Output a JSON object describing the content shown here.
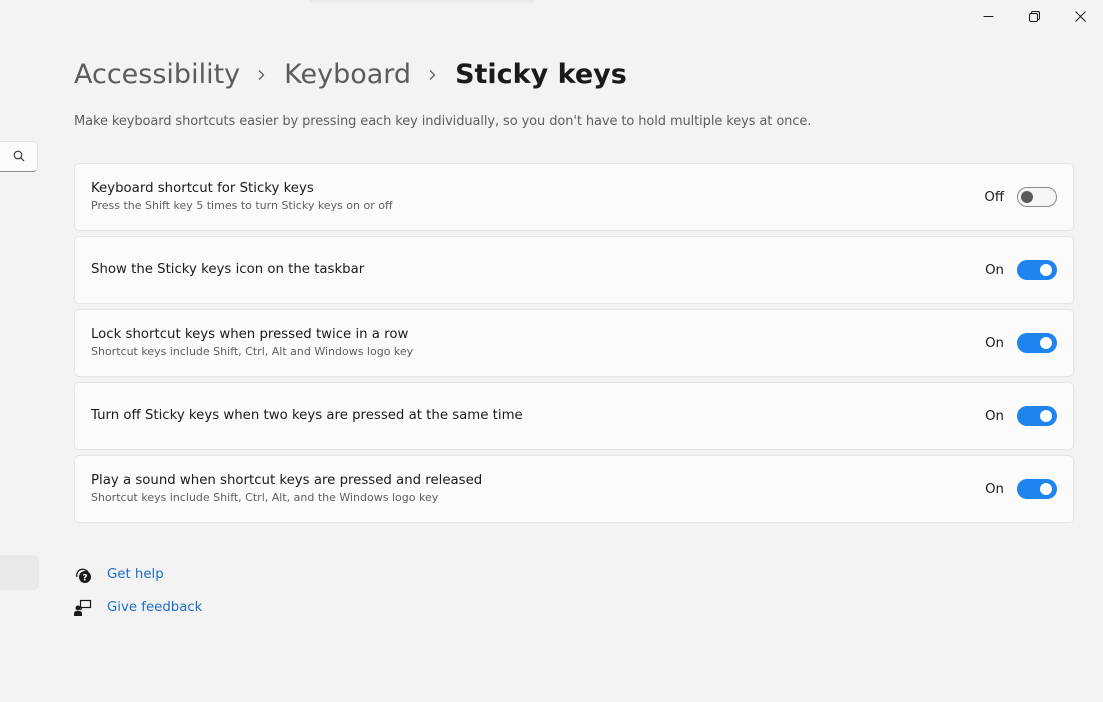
{
  "window": {
    "controls": {
      "minimize": "minimize",
      "maximize": "restore",
      "close": "close"
    }
  },
  "breadcrumb": {
    "items": [
      "Accessibility",
      "Keyboard"
    ],
    "current": "Sticky keys"
  },
  "description": "Make keyboard shortcuts easier by pressing each key individually, so you don't have to hold multiple keys at once.",
  "settings": [
    {
      "title": "Keyboard shortcut for Sticky keys",
      "subtitle": "Press the Shift key 5 times to turn Sticky keys on or off",
      "state": "Off",
      "on": false
    },
    {
      "title": "Show the Sticky keys icon on the taskbar",
      "subtitle": "",
      "state": "On",
      "on": true
    },
    {
      "title": "Lock shortcut keys when pressed twice in a row",
      "subtitle": "Shortcut keys include Shift, Ctrl, Alt and Windows logo key",
      "state": "On",
      "on": true
    },
    {
      "title": "Turn off Sticky keys when two keys are pressed at the same time",
      "subtitle": "",
      "state": "On",
      "on": true
    },
    {
      "title": "Play a sound when shortcut keys are pressed and released",
      "subtitle": "Shortcut keys include Shift, Ctrl, Alt, and the Windows logo key",
      "state": "On",
      "on": true
    }
  ],
  "links": {
    "get_help": "Get help",
    "give_feedback": "Give feedback"
  },
  "colors": {
    "accent": "#1f83f0",
    "link": "#1a6fd1",
    "background": "#f3f3f3",
    "card": "#fbfbfb"
  }
}
